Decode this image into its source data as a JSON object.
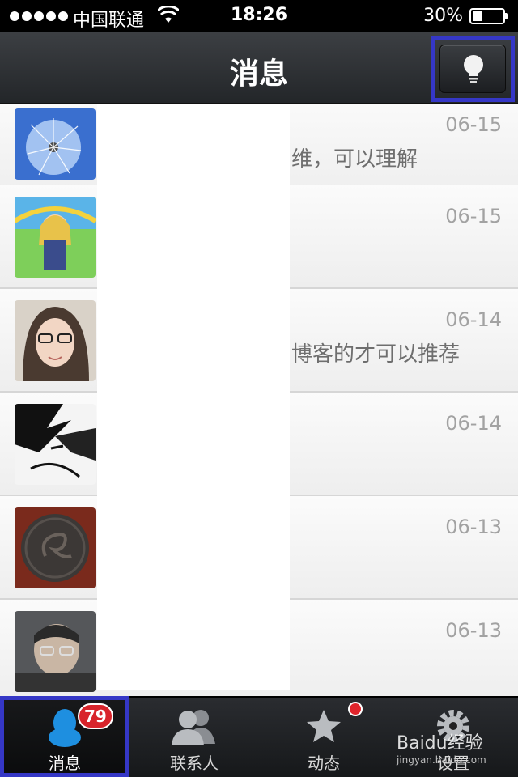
{
  "status_bar": {
    "carrier": "中国联通",
    "time": "18:26",
    "battery_text": "30%",
    "battery_level": 0.3
  },
  "nav": {
    "title": "消息"
  },
  "messages": [
    {
      "name": "",
      "date": "06-15",
      "preview": "维，可以理解"
    },
    {
      "name": "",
      "date": "06-15",
      "preview": ""
    },
    {
      "name": "",
      "date": "06-14",
      "preview": "博客的才可以推荐"
    },
    {
      "name": "",
      "date": "06-14",
      "preview": ""
    },
    {
      "name": "",
      "date": "06-13",
      "preview": ""
    },
    {
      "name": "",
      "date": "06-13",
      "preview": ""
    }
  ],
  "tabs": [
    {
      "label": "消息",
      "badge": "79"
    },
    {
      "label": "联系人"
    },
    {
      "label": "动态"
    },
    {
      "label": "设置"
    }
  ],
  "watermark": {
    "text": "Baidu经验",
    "sub": "jingyan.baidu.com"
  },
  "colors": {
    "highlight": "#3537c6",
    "badge": "#d8242b",
    "accent_blue": "#1e8fe0"
  }
}
